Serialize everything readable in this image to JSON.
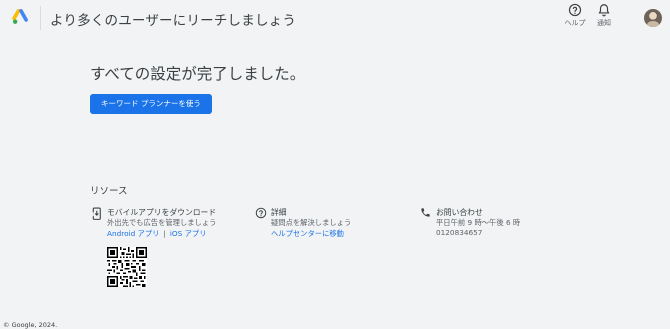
{
  "header": {
    "title": "より多くのユーザーにリーチしましょう",
    "help_label": "ヘルプ",
    "notifications_label": "通知"
  },
  "main": {
    "heading": "すべての設定が完了しました。",
    "cta_label": "キーワード プランナーを使う"
  },
  "resources": {
    "heading": "リソース",
    "mobile_app": {
      "title": "モバイルアプリをダウンロード",
      "subtitle": "外出先でも広告を管理しましょう",
      "android_link": "Android アプリ",
      "separator": "|",
      "ios_link": "iOS アプリ"
    },
    "details": {
      "title": "詳細",
      "subtitle": "疑問点を解決しましょう",
      "link": "ヘルプセンターに移動"
    },
    "contact": {
      "title": "お問い合わせ",
      "hours": "平日午前 9 時～午後 6 時",
      "phone": "0120834657"
    }
  },
  "footer": {
    "copyright": "© Google, 2024."
  },
  "colors": {
    "background": "#f1f3f4",
    "accent": "#1a73e8",
    "text": "#3c4043",
    "muted": "#5f6368"
  },
  "icons": {
    "logo": "google-ads-logo",
    "help": "help-circle-icon",
    "notifications": "bell-icon",
    "mobile": "phone-download-icon",
    "details": "help-circle-icon",
    "contact": "phone-icon"
  }
}
